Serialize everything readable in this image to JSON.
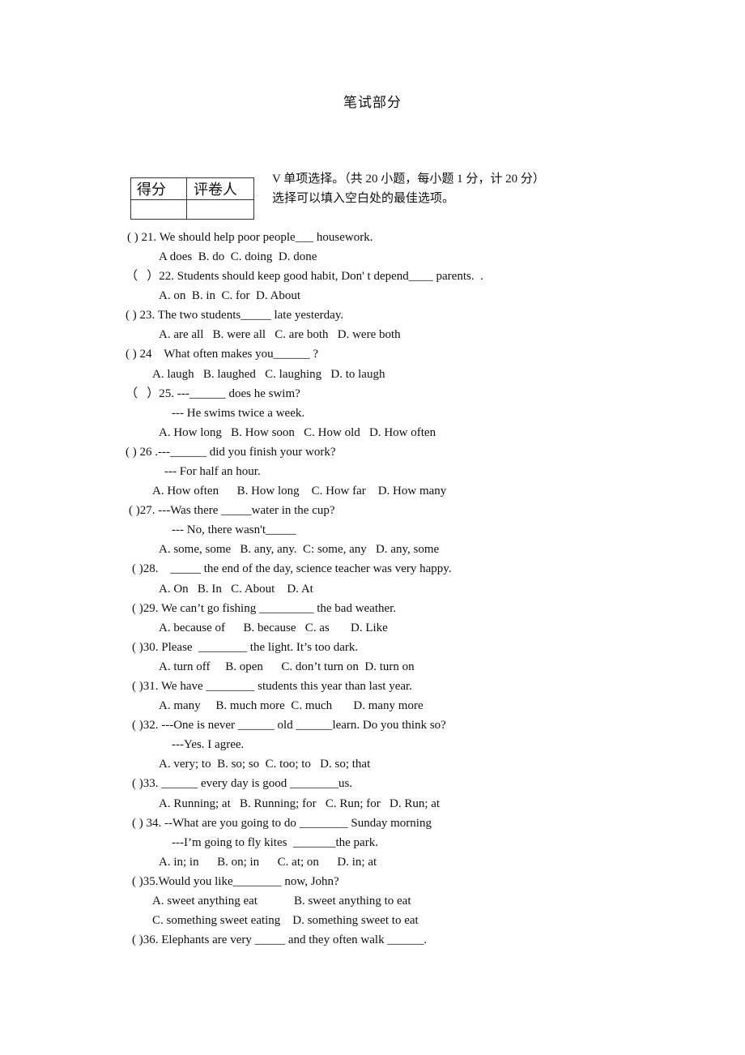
{
  "page_title": "笔试部分",
  "score_table": {
    "headers": [
      "得分",
      "评卷人"
    ],
    "values": [
      "",
      ""
    ]
  },
  "section": {
    "heading": "V 单项选择。（共 20 小题，每小题 1 分，计 20 分）",
    "instruction": "选择可以填入空白处的最佳选项。"
  },
  "lines": [
    "( ) 21. We should help poor people___ housework.",
    "A does  B. do  C. doing  D. done",
    "（   ）22. Students should keep good habit, Don' t depend____ parents.  .",
    "A. on  B. in  C. for  D. About",
    "( ) 23. The two students_____ late yesterday.",
    "A. are all   B. were all   C. are both   D. were both",
    "( ) 24    What often makes you______ ?",
    "A. laugh   B. laughed   C. laughing   D. to laugh",
    "（   ）25. ---______ does he swim?",
    "--- He swims twice a week.",
    "A. How long   B. How soon   C. How old   D. How often",
    "( ) 26 .---______ did you finish your work?",
    "--- For half an hour.",
    "A. How often      B. How long    C. How far    D. How many",
    "( )27. ---Was there _____water in the cup?",
    "--- No, there wasn't_____",
    "A. some, some   B. any, any.  C: some, any   D. any, some",
    "( )28.    _____ the end of the day, science teacher was very happy.",
    "A. On   B. In   C. About    D. At",
    "( )29. We can’t go fishing _________ the bad weather.",
    "A. because of      B. because   C. as       D. Like",
    "( )30. Please  ________ the light. It’s too dark.",
    "A. turn off     B. open      C. don’t turn on  D. turn on",
    "( )31. We have ________ students this year than last year.",
    "A. many     B. much more  C. much       D. many more",
    "( )32. ---One is never ______ old ______learn. Do you think so?",
    "---Yes. I agree.",
    "A. very; to  B. so; so  C. too; to   D. so; that",
    "( )33. ______ every day is good ________us.",
    "A. Running; at   B. Running; for   C. Run; for   D. Run; at",
    "( ) 34. --What are you going to do ________ Sunday morning",
    "---I’m going to fly kites  _______the park.",
    "A. in; in      B. on; in      C. at; on      D. in; at",
    "( )35.Would you like________ now, John?",
    "A. sweet anything eat            B. sweet anything to eat",
    "C. something sweet eating    D. something sweet to eat",
    "( )36. Elephants are very _____ and they often walk ______."
  ]
}
